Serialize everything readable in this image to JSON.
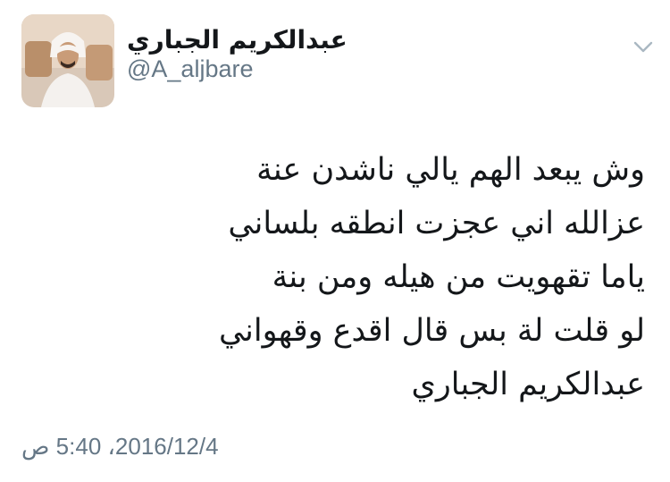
{
  "header": {
    "display_name": "عبدالكريم الجباري",
    "handle": "@A_aljbare",
    "avatar_icon": "user-photo",
    "menu_icon": "chevron-down-icon"
  },
  "tweet": {
    "lines": [
      "وش يبعد الهم يالي ناشدن عنة",
      "عزالله اني عجزت انطقه بلساني",
      "ياما تقهويت من هيله ومن بنة",
      "لو قلت لة بس قال اقدع وقهواني",
      "عبدالكريم الجباري"
    ]
  },
  "footer": {
    "timestamp": "2016/12/4، 5:40 ص"
  },
  "colors": {
    "text": "#14171a",
    "muted": "#657786",
    "chevron": "#aab8c2"
  }
}
